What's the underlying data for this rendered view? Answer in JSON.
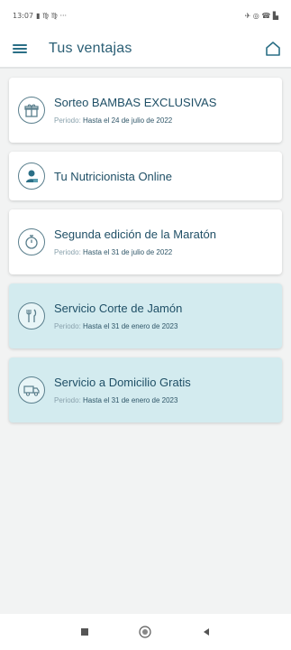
{
  "status_bar": {
    "time": "13:07",
    "extra": "▮ ♍ ♍ ···",
    "right_icons": "✈ ◎ ☎ ▙"
  },
  "header": {
    "title": "Tus ventajas",
    "menu_icon": "hamburger-icon",
    "home_icon": "home-icon"
  },
  "offers": [
    {
      "title": "Sorteo BAMBAS EXCLUSIVAS",
      "period_label": "Periodo:",
      "period_value": "Hasta el 24 de julio de 2022",
      "icon": "gift-icon",
      "highlight": false
    },
    {
      "title": "Tu Nutricionista Online",
      "icon": "nutritionist-icon",
      "highlight": false
    },
    {
      "title": "Segunda edición de la Maratón",
      "period_label": "Periodo:",
      "period_value": "Hasta el 31 de julio de 2022",
      "icon": "stopwatch-icon",
      "highlight": false
    },
    {
      "title": "Servicio Corte de Jamón",
      "period_label": "Periodo:",
      "period_value": "Hasta el 31 de enero de 2023",
      "icon": "cutlery-icon",
      "highlight": true
    },
    {
      "title": "Servicio a Domicilio Gratis",
      "period_label": "Periodo:",
      "period_value": "Hasta el 31 de enero de 2023",
      "icon": "delivery-truck-icon",
      "highlight": true
    }
  ],
  "colors": {
    "accent": "#2b6f86",
    "highlight_card": "#d3ebef",
    "background": "#f2f3f3"
  },
  "nav_bar": {
    "recent_icon": "recent-apps-icon",
    "home_icon": "system-home-icon",
    "back_icon": "back-icon"
  }
}
